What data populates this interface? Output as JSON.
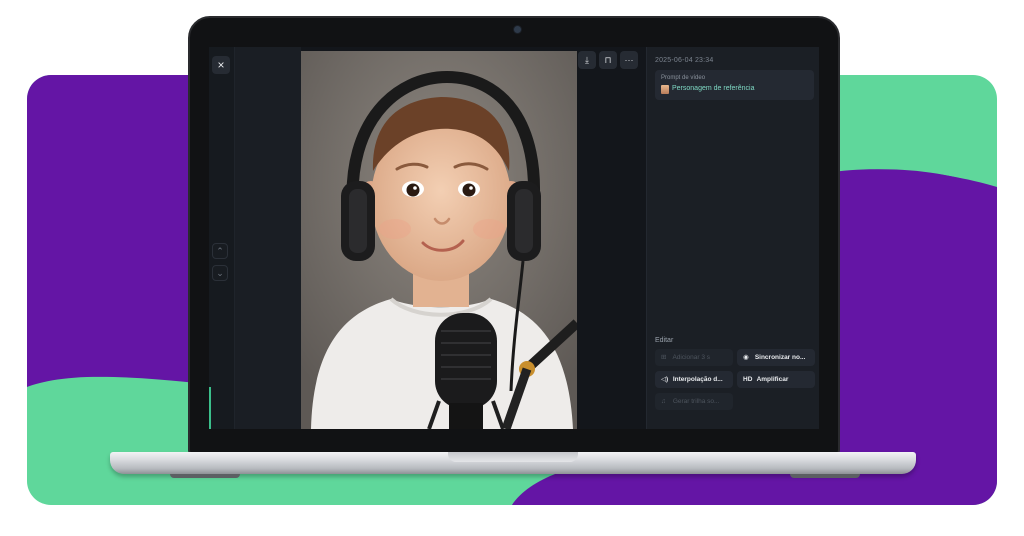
{
  "colors": {
    "purple": "#6415a5",
    "green": "#5fd79b",
    "accent_text": "#7fd9c4"
  },
  "app": {
    "close_icon": "×",
    "nav": {
      "up_icon": "⌃",
      "down_icon": "⌄"
    },
    "toolbar": {
      "download_icon": "⤓",
      "bookmark_icon": "⊓",
      "more_icon": "···"
    }
  },
  "side": {
    "timestamp": "2025-06-04 23:34",
    "prompt_label": "Prompt de vídeo",
    "reference_label": "Personagem de referência",
    "edit_title": "Editar",
    "edit_buttons": [
      {
        "label": "Adicionar 3 s",
        "icon": "plus-icon",
        "glyph": "⊞",
        "enabled": false
      },
      {
        "label": "Sincronizar no...",
        "icon": "eye-icon",
        "glyph": "◉",
        "enabled": true
      },
      {
        "label": "Interpolação d...",
        "icon": "sound-icon",
        "glyph": "◁)",
        "enabled": true
      },
      {
        "label": "Amplificar",
        "icon": "hd-icon",
        "glyph": "HD",
        "enabled": true
      },
      {
        "label": "Gerar trilha so...",
        "icon": "music-icon",
        "glyph": "♫",
        "enabled": false
      }
    ]
  }
}
